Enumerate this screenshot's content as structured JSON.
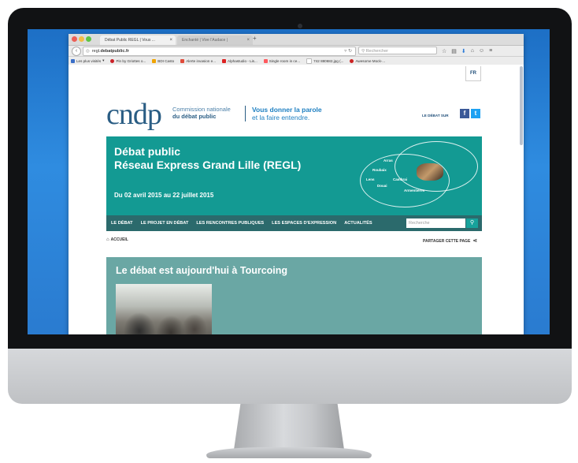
{
  "browser": {
    "tabs": [
      {
        "label": "Débat Public REGL | Vous ..."
      },
      {
        "label": "Enchanté | Vive l'Audace |"
      }
    ],
    "url_prefix": "regl.",
    "url_domain": "debatpublic.fr",
    "search_placeholder": "Rechercher",
    "bookmarks": [
      {
        "label": "Les plus visités",
        "color": "#3a6fc8"
      },
      {
        "label": "Pin by Griottes o...",
        "color": "#cb2027"
      },
      {
        "label": "BDI Casto",
        "color": "#f0a400"
      },
      {
        "label": "Alerte invasion e...",
        "color": "#e04b3a"
      },
      {
        "label": "Alphastudio - Lis...",
        "color": "#d22"
      },
      {
        "label": "Single room in ce...",
        "color": "#ff5a5f"
      },
      {
        "label": "742 880682.jpg (...",
        "color": "#bbbbbb"
      },
      {
        "label": "Awesome Mock-...",
        "color": "#c22"
      }
    ]
  },
  "site": {
    "lang": "FR",
    "logo": "cndp",
    "logo_sub_1": "Commission nationale",
    "logo_sub_2": "du débat public",
    "tagline_1": "Vous donner la parole",
    "tagline_2": "et la faire entendre.",
    "social_label": "LE DÉBAT SUR",
    "banner": {
      "title_1": "Débat public",
      "title_2": "Réseau Express Grand Lille (REGL)",
      "dates": "Du 02 avril 2015 au 22 juillet 2015",
      "cities": [
        "Arras",
        "Roubaix",
        "Lens",
        "Douai",
        "Cambrai",
        "Armentières"
      ]
    },
    "menu": [
      "LE DÉBAT",
      "LE PROJET EN DÉBAT",
      "LES RENCONTRES PUBLIQUES",
      "LES ESPACES D'EXPRESSION",
      "ACTUALITÉS"
    ],
    "menu_search_placeholder": "Recherche",
    "breadcrumb": "ACCUEIL",
    "share_label": "PARTAGER CETTE PAGE",
    "article_title": "Le débat est aujourd'hui à Tourcoing"
  },
  "colors": {
    "brand_teal": "#139a93",
    "menu_teal": "#2b6a6c",
    "article_teal": "#6aa7a4",
    "brand_blue": "#2a5d84"
  }
}
